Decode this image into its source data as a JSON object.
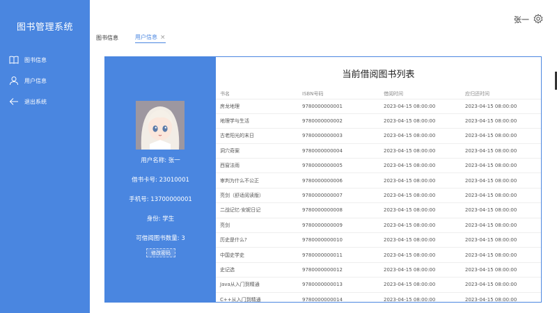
{
  "sidebar": {
    "brand": "图书管理系统",
    "items": [
      {
        "label": "图书信息",
        "icon": "book-icon"
      },
      {
        "label": "用户信息",
        "icon": "user-icon"
      },
      {
        "label": "退出系统",
        "icon": "arrow-left-icon"
      }
    ]
  },
  "header": {
    "username": "张一",
    "settings_icon": "gear-icon"
  },
  "tabs": [
    {
      "label": "图书信息",
      "active": false
    },
    {
      "label": "用户信息",
      "active": true,
      "close": "×"
    }
  ],
  "profile": {
    "username_line": "用户名称: 张一",
    "card_line": "借书卡号: 23010001",
    "phone_line": "手机号: 13700000001",
    "role_line": "身份: 学生",
    "count_line": "可借阅图书数量: 3",
    "change_password_label": "修改密码"
  },
  "borrow_table": {
    "title": "当前借阅图书列表",
    "headers": [
      "书名",
      "ISBN号码",
      "借阅时间",
      "应归还时间"
    ],
    "rows": [
      [
        "房龙地理",
        "9780000000001",
        "2023-04-15 08:00:00",
        "2023-04-15 08:00:00"
      ],
      [
        "地理学与生活",
        "9780000000002",
        "2023-04-15 08:00:00",
        "2023-04-15 08:00:00"
      ],
      [
        "古老阳光的末日",
        "9780000000003",
        "2023-04-15 08:00:00",
        "2023-04-15 08:00:00"
      ],
      [
        "洞穴奇案",
        "9780000000004",
        "2023-04-15 08:00:00",
        "2023-04-15 08:00:00"
      ],
      [
        "西窗法雨",
        "9780000000005",
        "2023-04-15 08:00:00",
        "2023-04-15 08:00:00"
      ],
      [
        "审判为什么不公正",
        "9780000000006",
        "2023-04-15 08:00:00",
        "2023-04-15 08:00:00"
      ],
      [
        "亮剑（舒适阅读版）",
        "9780000000007",
        "2023-04-15 08:00:00",
        "2023-04-15 08:00:00"
      ],
      [
        "二战记忆·安妮日记",
        "9780000000008",
        "2023-04-15 08:00:00",
        "2023-04-15 08:00:00"
      ],
      [
        "亮剑",
        "9780000000009",
        "2023-04-15 08:00:00",
        "2023-04-15 08:00:00"
      ],
      [
        "历史是什么?",
        "9780000000010",
        "2023-04-15 08:00:00",
        "2023-04-15 08:00:00"
      ],
      [
        "中国史学史",
        "9780000000011",
        "2023-04-15 08:00:00",
        "2023-04-15 08:00:00"
      ],
      [
        "史记选",
        "9780000000012",
        "2023-04-15 08:00:00",
        "2023-04-15 08:00:00"
      ],
      [
        "Java从入门到精通",
        "9780000000013",
        "2023-04-15 08:00:00",
        "2023-04-15 08:00:00"
      ],
      [
        "C++从入门到精通",
        "9780000000014",
        "2023-04-15 08:00:00",
        "2023-04-15 08:00:00"
      ]
    ]
  },
  "colors": {
    "primary": "#4a86e0"
  }
}
